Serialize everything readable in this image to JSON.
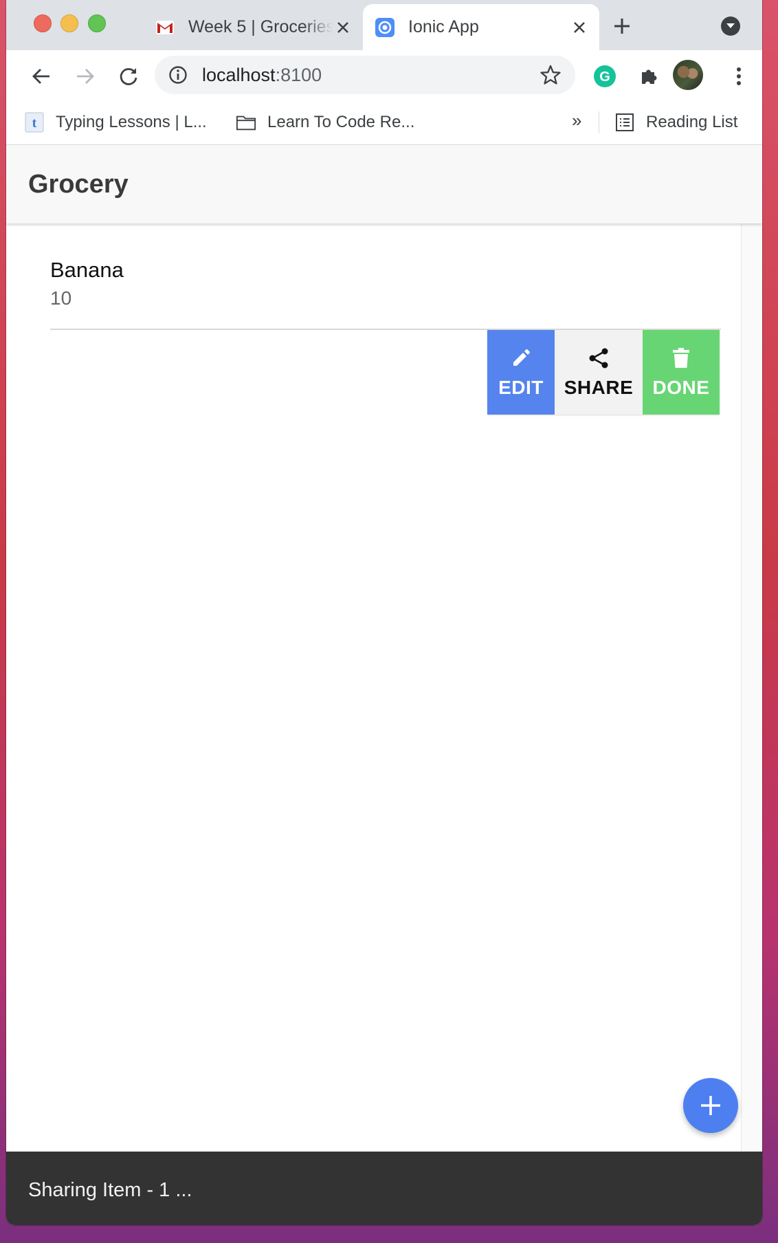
{
  "browser": {
    "tabs": [
      {
        "title": "Week 5 | Groceries",
        "favicon": "gmail-icon",
        "active": false
      },
      {
        "title": "Ionic App",
        "favicon": "ionic-icon",
        "active": true
      }
    ],
    "address": {
      "host": "localhost",
      "port": ":8100"
    },
    "bookmarks": [
      {
        "label": "Typing Lessons | L...",
        "icon": "typing-favicon"
      },
      {
        "label": "Learn To Code Re...",
        "icon": "folder-icon"
      }
    ],
    "bookmarks_overflow": "»",
    "reading_list": "Reading List",
    "extension_letter": "G"
  },
  "app": {
    "title": "Grocery",
    "items": [
      {
        "name": "Banana",
        "quantity": "10"
      }
    ],
    "item_options": {
      "edit": "EDIT",
      "share": "SHARE",
      "done": "DONE"
    },
    "toast": "Sharing Item - 1 ..."
  },
  "colors": {
    "edit": "#5584ee",
    "share": "#f2f2f2",
    "done": "#68d574",
    "fab": "#4d7ff0",
    "toast": "#333333"
  }
}
